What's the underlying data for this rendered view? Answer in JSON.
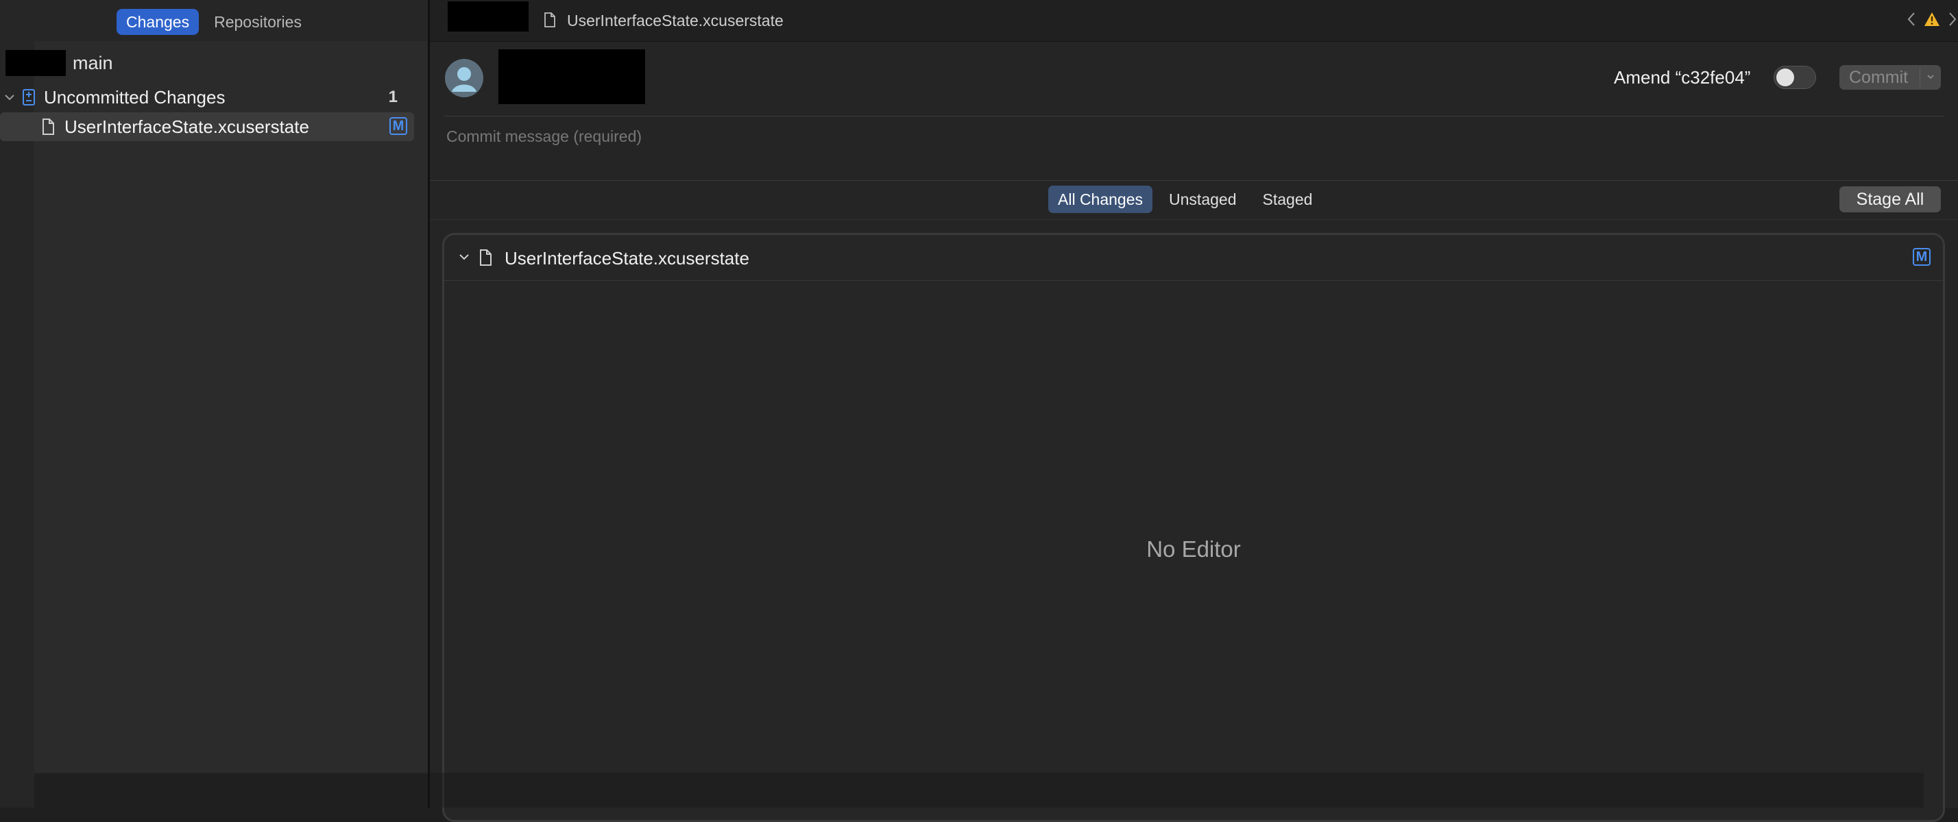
{
  "sidebar": {
    "tabs": [
      {
        "label": "Changes",
        "active": true
      },
      {
        "label": "Repositories",
        "active": false
      }
    ],
    "branch": "main",
    "uncommitted": {
      "label": "Uncommitted Changes",
      "count": "1"
    },
    "files": [
      {
        "name": "UserInterfaceState.xcuserstate",
        "status": "M"
      }
    ]
  },
  "titlebar": {
    "file_name": "UserInterfaceState.xcuserstate",
    "icons": [
      "back-chevron-icon",
      "warning-icon",
      "forward-chevron-icon"
    ]
  },
  "commit": {
    "amend_label": "Amend “c32fe04”",
    "amend_on": false,
    "button_label": "Commit",
    "message_value": "",
    "message_placeholder": "Commit message (required)"
  },
  "filter": {
    "segments": [
      {
        "label": "All Changes",
        "active": true
      },
      {
        "label": "Unstaged",
        "active": false
      },
      {
        "label": "Staged",
        "active": false
      }
    ],
    "stage_all_label": "Stage All"
  },
  "diff": {
    "file_name": "UserInterfaceState.xcuserstate",
    "status": "M",
    "empty_text": "No Editor"
  },
  "colors": {
    "accent": "#2f63cc",
    "badge": "#4a8ef0",
    "warning": "#f0b429",
    "background": "#1f1f1f"
  }
}
